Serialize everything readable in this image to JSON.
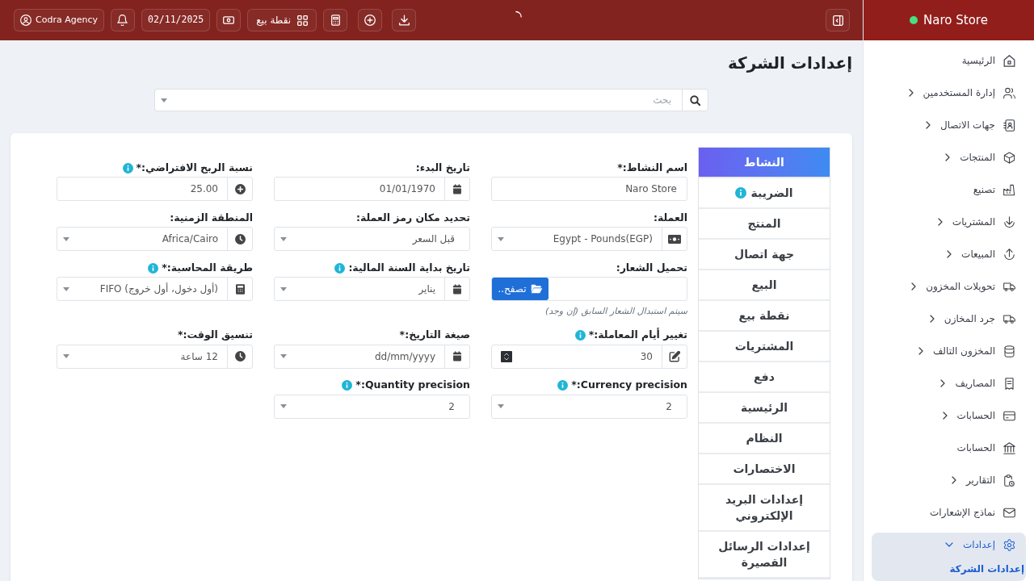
{
  "topbar": {
    "user_button": "Codra Agency",
    "date": "02/11/2025",
    "pos_button": "نقطة بيع"
  },
  "sidebar": {
    "brand": "Naro Store",
    "items": [
      {
        "label": "الرئيسية",
        "kind": "link",
        "expanded": false,
        "selected": false
      },
      {
        "label": "إدارة المستخدمين",
        "kind": "group",
        "expanded": false,
        "selected": false
      },
      {
        "label": "جهات الاتصال",
        "kind": "group",
        "expanded": false,
        "selected": false
      },
      {
        "label": "المنتجات",
        "kind": "group",
        "expanded": false,
        "selected": false
      },
      {
        "label": "تصنيع",
        "kind": "link",
        "expanded": false,
        "selected": false
      },
      {
        "label": "المشتريات",
        "kind": "group",
        "expanded": false,
        "selected": false
      },
      {
        "label": "المبيعات",
        "kind": "group",
        "expanded": false,
        "selected": false
      },
      {
        "label": "تحويلات المخزون",
        "kind": "group",
        "expanded": false,
        "selected": false
      },
      {
        "label": "جرد المخازن",
        "kind": "group",
        "expanded": false,
        "selected": false
      },
      {
        "label": "المخزون التالف",
        "kind": "group",
        "expanded": false,
        "selected": false
      },
      {
        "label": "المصاريف",
        "kind": "group",
        "expanded": false,
        "selected": false
      },
      {
        "label": "الحسابات",
        "kind": "group",
        "expanded": false,
        "selected": false
      },
      {
        "label": "الحسابات",
        "kind": "link",
        "expanded": false,
        "selected": false
      },
      {
        "label": "التقارير",
        "kind": "group",
        "expanded": false,
        "selected": false
      },
      {
        "label": "نماذج الإشعارات",
        "kind": "link",
        "expanded": false,
        "selected": false
      },
      {
        "label": "إعدادات",
        "kind": "group",
        "expanded": true,
        "selected": true,
        "children": [
          {
            "label": "إعدادات الشركة",
            "selected": true
          }
        ]
      }
    ]
  },
  "page": {
    "title": "إعدادات الشركة",
    "search": {
      "placeholder": "بحث"
    }
  },
  "tabs": [
    {
      "label": "النشاط",
      "selected": true
    },
    {
      "label": "الضريبة",
      "selected": false,
      "info": true
    },
    {
      "label": "المنتج",
      "selected": false
    },
    {
      "label": "جهة اتصال",
      "selected": false
    },
    {
      "label": "البيع",
      "selected": false
    },
    {
      "label": "نقطة بيع",
      "selected": false
    },
    {
      "label": "المشتريات",
      "selected": false
    },
    {
      "label": "دفع",
      "selected": false
    },
    {
      "label": "الرئيسية",
      "selected": false
    },
    {
      "label": "النظام",
      "selected": false
    },
    {
      "label": "الاختصارات",
      "selected": false
    },
    {
      "label": "إعدادات البريد الإلكتروني",
      "selected": false
    },
    {
      "label": "إعدادات الرسائل القصيرة",
      "selected": false
    }
  ],
  "fields": [
    {
      "label": "اسم النشاط:*",
      "kind": "text",
      "value": "Naro Store"
    },
    {
      "label": "تاريخ البدء:",
      "kind": "date",
      "value": "01/01/1970"
    },
    {
      "label": "نسبة الربح الافتراضي:*",
      "info": true,
      "kind": "text",
      "value": "25.00"
    },
    {
      "label": "العملة:",
      "kind": "select",
      "value": "Egypt - Pounds(EGP)"
    },
    {
      "label": "تحديد مكان رمز العملة:",
      "kind": "select",
      "value": "قبل السعر"
    },
    {
      "label": "المنطقة الزمنية:",
      "kind": "select",
      "value": "Africa/Cairo"
    },
    {
      "label": "تحميل الشعار:",
      "kind": "file",
      "button": "تصفح..",
      "help": "سيتم استبدال الشعار السابق (إن وجد)"
    },
    {
      "label": "تاريخ بداية السنة المالية:",
      "info": true,
      "kind": "select",
      "value": "يناير"
    },
    {
      "label": "طريقة المحاسبة:*",
      "info": true,
      "kind": "select",
      "value": "(أول دخول، أول خروج) FIFO"
    },
    {
      "label": "تغيير أيام المعاملة:*",
      "info": true,
      "kind": "number",
      "value": "30"
    },
    {
      "label": "صيغة التاريخ:*",
      "kind": "select",
      "value": "dd/mm/yyyy"
    },
    {
      "label": "تنسيق الوقت:*",
      "kind": "select",
      "value": "12 ساعة"
    },
    {
      "label": "Currency precision:*",
      "info": true,
      "kind": "select",
      "value": "2"
    },
    {
      "label": "Quantity precision:*",
      "info": true,
      "kind": "select",
      "value": "2"
    }
  ]
}
